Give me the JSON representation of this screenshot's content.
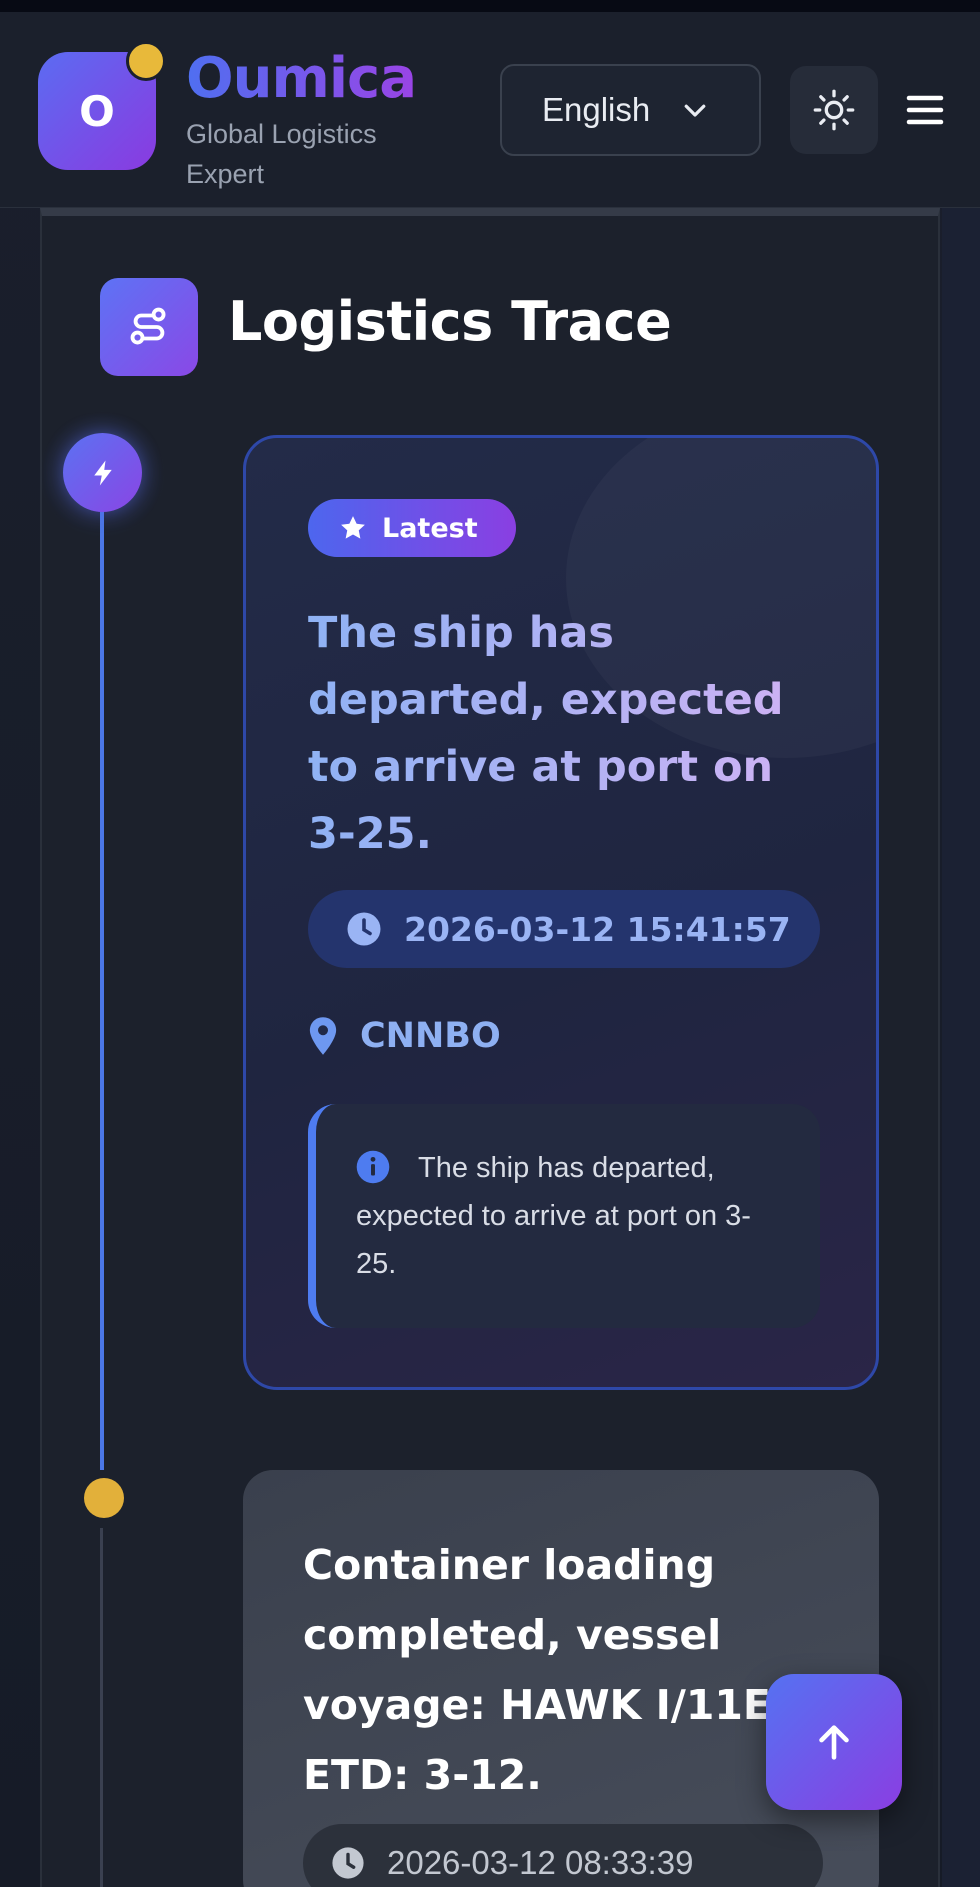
{
  "header": {
    "logo_letter": "O",
    "brand_name": "Oumica",
    "tagline": "Global Logistics Expert",
    "language": "English"
  },
  "section": {
    "title": "Logistics Trace"
  },
  "timeline": [
    {
      "badge": "Latest",
      "title": "The ship has departed, expected to arrive at port on 3-25.",
      "time": "2026-03-12 15:41:57",
      "location": "CNNBO",
      "note": "The ship has departed, expected to arrive at port on 3-25."
    },
    {
      "title": "Container loading completed, vessel voyage: HAWK I/11E, ETD: 3-12.",
      "time": "2026-03-12 08:33:39"
    }
  ],
  "colors": {
    "accent_blue": "#4f6ff0",
    "accent_purple": "#8a3fe2",
    "secondary_dot": "#e2b03a"
  },
  "icons": {
    "theme": "sun-icon",
    "menu": "hamburger-icon",
    "section": "route-icon",
    "latest_node": "lightning-icon",
    "badge": "star-icon",
    "time": "clock-icon",
    "location": "map-pin-icon",
    "note": "info-icon",
    "scroll": "arrow-up-icon"
  }
}
